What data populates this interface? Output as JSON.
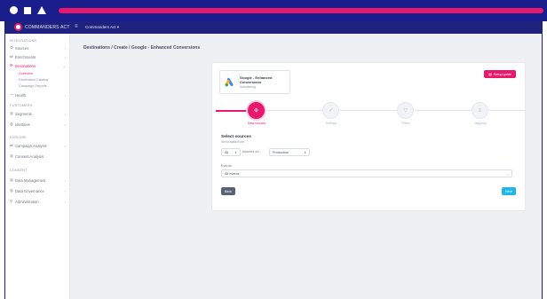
{
  "header": {
    "logo_text": "COMMANDERS ACT",
    "menu_glyph": "≡",
    "account": "Commanders Act ▾"
  },
  "sidebar": {
    "sections": [
      "INTEGRATIONS",
      "CUSTOMERS",
      "EXPLORE",
      "CONSENT"
    ],
    "items": [
      {
        "label": "Sources",
        "icon": "gear-icon",
        "glyph": "⚙",
        "chevron": "›"
      },
      {
        "label": "Enrichments",
        "icon": "sliders-icon",
        "glyph": "⇄",
        "chevron": "›"
      },
      {
        "label": "Destinations",
        "icon": "destination-icon",
        "glyph": "⟳",
        "chevron": "⌄"
      },
      {
        "label": "Health",
        "icon": "pulse-icon",
        "glyph": "⁓",
        "chevron": "›"
      },
      {
        "label": "Segments",
        "icon": "segments-icon",
        "glyph": "◍",
        "chevron": "›"
      },
      {
        "label": "Identities",
        "icon": "identities-icon",
        "glyph": "◍",
        "chevron": "›"
      },
      {
        "label": "Campaign Analysis",
        "icon": "chart-icon",
        "glyph": "⇄",
        "chevron": "›"
      },
      {
        "label": "Consent Analysis",
        "icon": "consent-icon",
        "glyph": "◍",
        "chevron": ""
      },
      {
        "label": "Data Management",
        "icon": "database-icon",
        "glyph": "◍",
        "chevron": "›"
      },
      {
        "label": "Data Governance",
        "icon": "governance-icon",
        "glyph": "◍",
        "chevron": "›"
      },
      {
        "label": "Administration",
        "icon": "wrench-icon",
        "glyph": "⚲",
        "chevron": "›"
      }
    ],
    "sub_items": [
      "Overview",
      "Destination Catalog",
      "Campaign Reports"
    ]
  },
  "breadcrumb": "Destinations / Create / Google - Enhanced Conversions",
  "destination": {
    "name": "Google - Enhanced Conversions",
    "type": "Advertising"
  },
  "setup_guide_label": "Setup guide",
  "steps": [
    {
      "label": "Data sources",
      "glyph": "⊕"
    },
    {
      "label": "Settings",
      "glyph": "✓"
    },
    {
      "label": "Filters",
      "glyph": "▽"
    },
    {
      "label": "Mapping",
      "glyph": "≡"
    }
  ],
  "sources": {
    "title": "Select sources",
    "subtitle": "Send data from",
    "scope_value": "All",
    "sources_on_label": "sources on",
    "environment_value": "Production"
  },
  "events": {
    "label": "Events",
    "value": "All events"
  },
  "buttons": {
    "back": "Back",
    "next": "Next"
  },
  "colors": {
    "brand": "#1f237f",
    "accent": "#e8196c",
    "next": "#1fb6e8"
  }
}
